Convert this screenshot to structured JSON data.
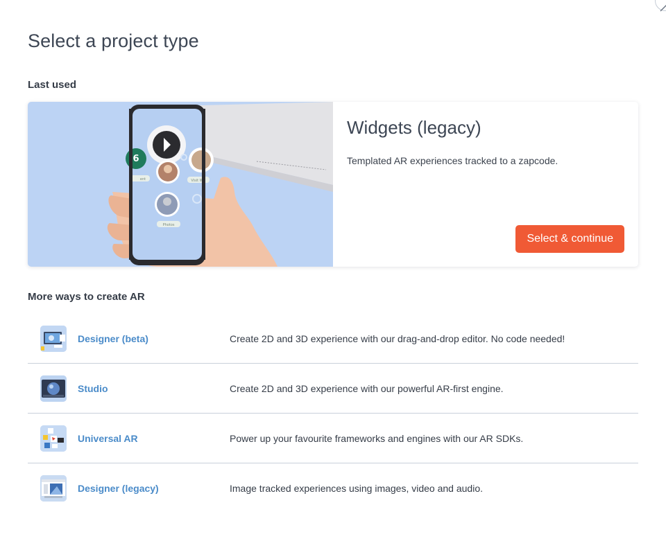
{
  "modal": {
    "title": "Select a project type"
  },
  "last_used": {
    "section_label": "Last used",
    "title": "Widgets (legacy)",
    "description": "Templated AR experiences tracked to a zapcode.",
    "button_label": "Select & continue",
    "image_captions": {
      "left_chip": "ent",
      "right_chip": "Visit W",
      "bottom_chip": "Photos",
      "badge_number": "6"
    }
  },
  "more_ways": {
    "section_label": "More ways to create AR",
    "items": [
      {
        "name": "Designer (beta)",
        "description": "Create 2D and 3D experience with our drag-and-drop editor. No code needed!",
        "icon": "designer-beta-thumbnail"
      },
      {
        "name": "Studio",
        "description": "Create 2D and 3D experience with our powerful AR-first engine.",
        "icon": "studio-thumbnail"
      },
      {
        "name": "Universal AR",
        "description": "Power up your favourite frameworks and engines with our AR SDKs.",
        "icon": "universal-ar-thumbnail"
      },
      {
        "name": "Designer (legacy)",
        "description": "Image tracked experiences using images, video and audio.",
        "icon": "designer-legacy-thumbnail"
      }
    ]
  },
  "colors": {
    "accent": "#f05a35",
    "link": "#4a8bc9",
    "image_bg": "#bcd3f4",
    "divider": "#c8d0da"
  }
}
